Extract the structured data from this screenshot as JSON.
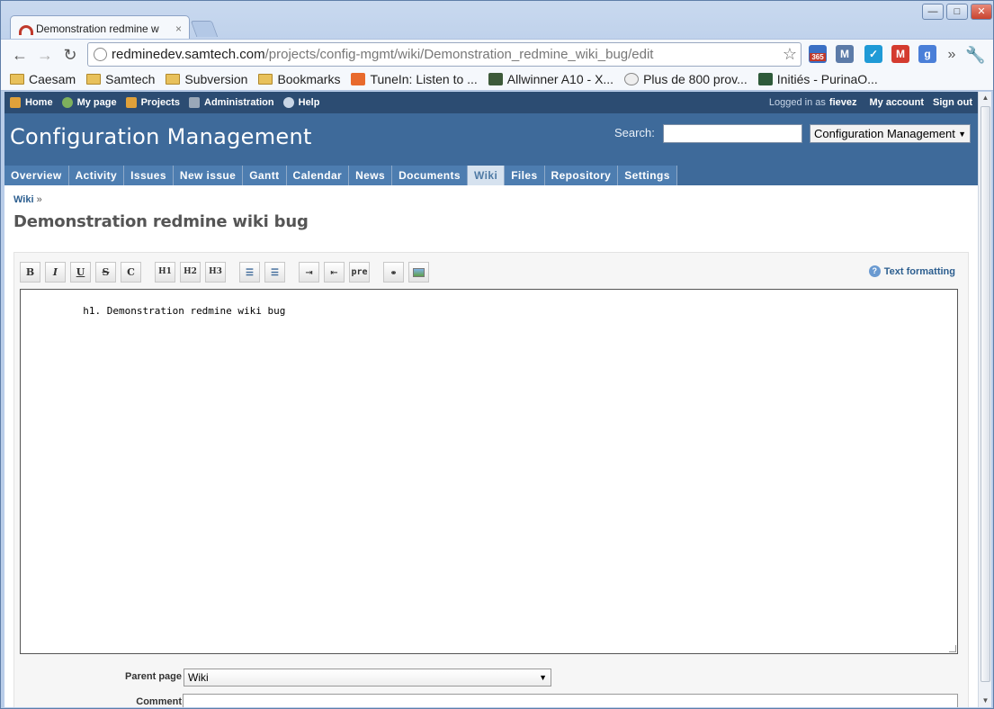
{
  "browser": {
    "tab_title": "Demonstration redmine w",
    "tab_close": "×",
    "window_controls": [
      "—",
      "□",
      "✕"
    ],
    "url_host": "redminedev.samtech.com",
    "url_path": "/projects/config-mgmt/wiki/Demonstration_redmine_wiki_bug/edit",
    "ext_badge": "365",
    "overflow": "»",
    "bookmarks": [
      {
        "label": "Caesam",
        "type": "folder"
      },
      {
        "label": "Samtech",
        "type": "folder"
      },
      {
        "label": "Subversion",
        "type": "folder"
      },
      {
        "label": "Bookmarks",
        "type": "folder"
      },
      {
        "label": "TuneIn: Listen to ...",
        "type": "page"
      },
      {
        "label": "Allwinner A10 - X...",
        "type": "page"
      },
      {
        "label": "Plus de 800 prov...",
        "type": "page"
      },
      {
        "label": "Initiés - PurinaO...",
        "type": "page"
      }
    ]
  },
  "topmenu": {
    "home": "Home",
    "my_page": "My page",
    "projects": "Projects",
    "administration": "Administration",
    "help": "Help",
    "logged_in_as": "Logged in as",
    "user": "fievez",
    "my_account": "My account",
    "sign_out": "Sign out"
  },
  "header": {
    "project_title": "Configuration Management",
    "search_label": "Search:",
    "search_value": "",
    "project_jump": "Configuration Management"
  },
  "mainmenu": [
    "Overview",
    "Activity",
    "Issues",
    "New issue",
    "Gantt",
    "Calendar",
    "News",
    "Documents",
    "Wiki",
    "Files",
    "Repository",
    "Settings"
  ],
  "mainmenu_selected": "Wiki",
  "breadcrumb": {
    "link": "Wiki",
    "sep": "»"
  },
  "page_title": "Demonstration redmine wiki bug",
  "editor": {
    "buttons": [
      "B",
      "I",
      "U",
      "S",
      "C",
      "H1",
      "H2",
      "H3",
      "ul",
      "ol",
      "indent",
      "outdent",
      "pre",
      "link",
      "image"
    ],
    "text_formatting": "Text formatting",
    "content": "h1. Demonstration redmine wiki bug"
  },
  "form": {
    "parent_label": "Parent page",
    "parent_value": "Wiki",
    "comment_label": "Comment",
    "comment_value": ""
  }
}
